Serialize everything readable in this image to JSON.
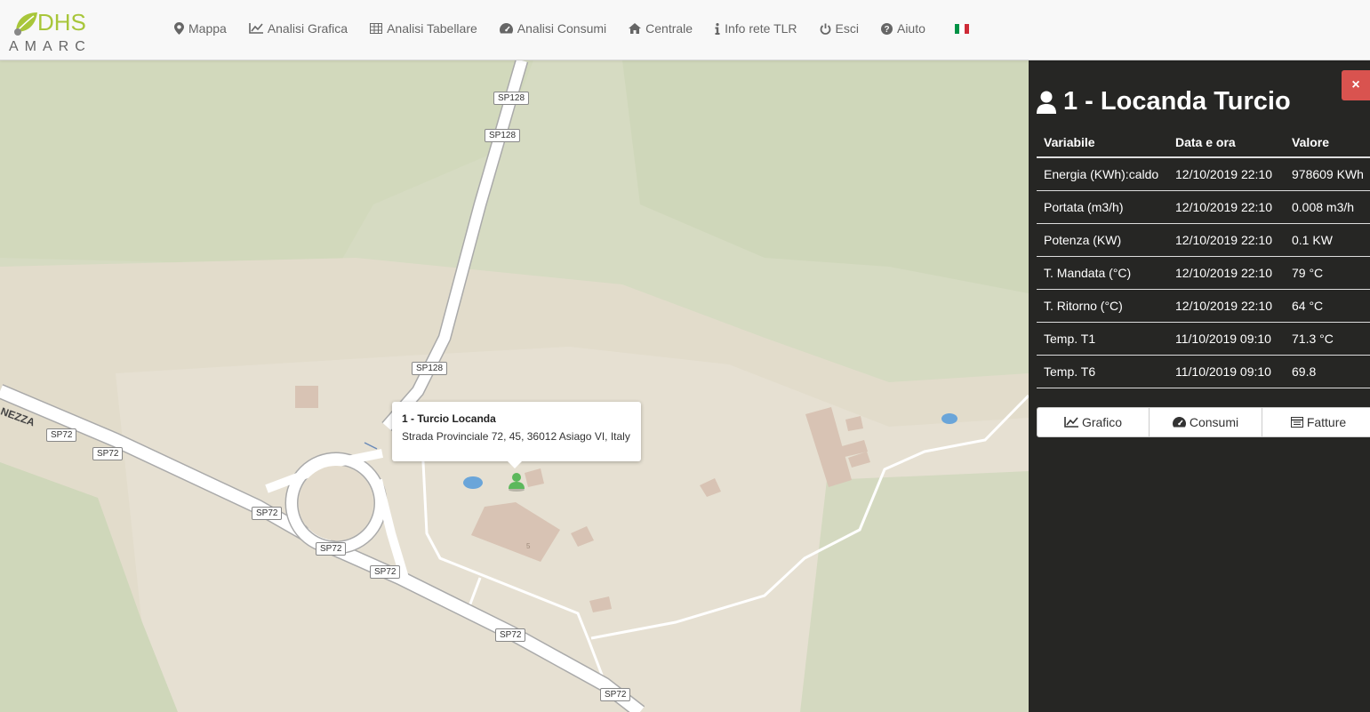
{
  "logo": {
    "brand": "DHS",
    "sub": "AMARC"
  },
  "nav": [
    {
      "label": "Mappa",
      "icon": "map-marker-icon"
    },
    {
      "label": "Analisi Grafica",
      "icon": "line-chart-icon"
    },
    {
      "label": "Analisi Tabellare",
      "icon": "table-icon"
    },
    {
      "label": "Analisi Consumi",
      "icon": "dashboard-icon"
    },
    {
      "label": "Centrale",
      "icon": "home-icon"
    },
    {
      "label": "Info rete TLR",
      "icon": "info-icon"
    },
    {
      "label": "Esci",
      "icon": "power-icon"
    },
    {
      "label": "Aiuto",
      "icon": "question-circle-icon"
    }
  ],
  "map": {
    "roads": {
      "sp128_a": "SP128",
      "sp128_b": "SP128",
      "sp128_c": "SP128",
      "sp72_a": "SP72",
      "sp72_b": "SP72",
      "sp72_c": "SP72",
      "sp72_d": "SP72",
      "sp72_e": "SP72",
      "sp72_f": "SP72",
      "sp72_g": "SP72"
    },
    "street_name": "NEZZA",
    "building_number": "5",
    "popup": {
      "title": "1 - Turcio Locanda",
      "address": "Strada Provinciale 72, 45, 36012 Asiago VI, Italy"
    }
  },
  "panel": {
    "close": "×",
    "title": "1 - Locanda Turcio",
    "columns": [
      "Variabile",
      "Data e ora",
      "Valore"
    ],
    "rows": [
      [
        "Energia (KWh):caldo",
        "12/10/2019 22:10",
        "978609 KWh"
      ],
      [
        "Portata (m3/h)",
        "12/10/2019 22:10",
        "0.008 m3/h"
      ],
      [
        "Potenza (KW)",
        "12/10/2019 22:10",
        "0.1 KW"
      ],
      [
        "T. Mandata (°C)",
        "12/10/2019 22:10",
        "79 °C"
      ],
      [
        "T. Ritorno (°C)",
        "12/10/2019 22:10",
        "64 °C"
      ],
      [
        "Temp. T1",
        "11/10/2019 09:10",
        "71.3 °C"
      ],
      [
        "Temp. T6",
        "11/10/2019 09:10",
        "69.8"
      ]
    ],
    "buttons": [
      {
        "label": "Grafico",
        "icon": "line-chart-icon"
      },
      {
        "label": "Consumi",
        "icon": "dashboard-icon"
      },
      {
        "label": "Fatture",
        "icon": "list-icon"
      }
    ]
  },
  "colors": {
    "accent_green": "#a8c63a",
    "close_red": "#d9534f",
    "panel_bg": "#262624",
    "marker_green": "#5cb85c"
  }
}
